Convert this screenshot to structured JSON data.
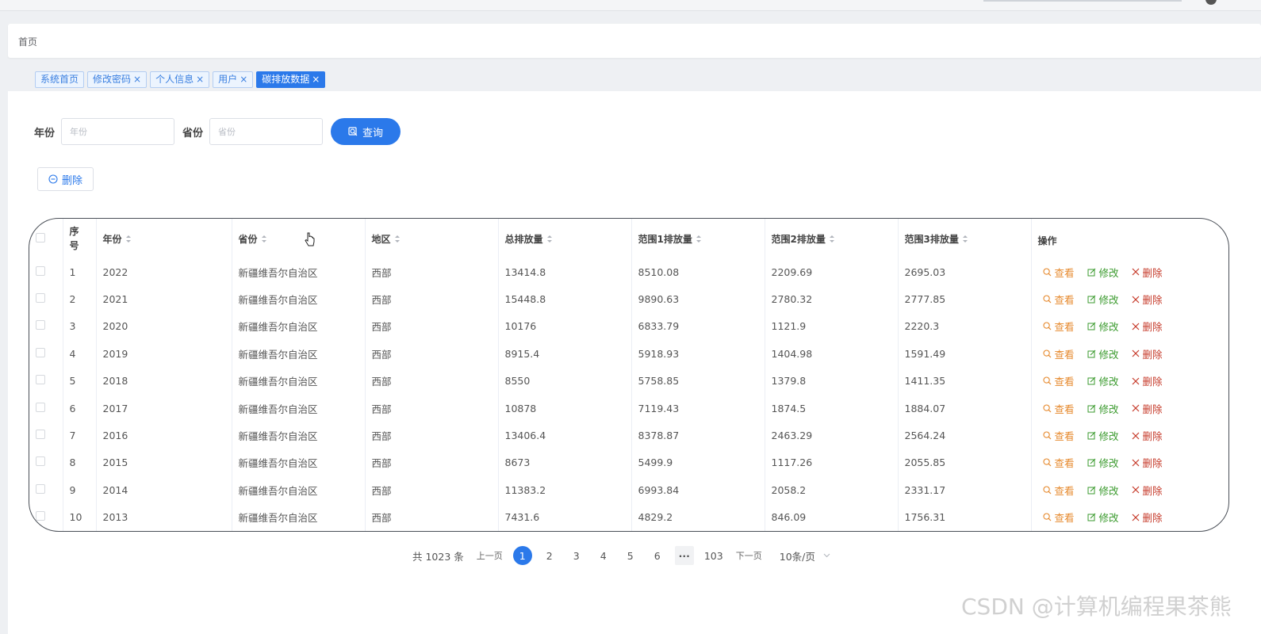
{
  "breadcrumb": {
    "home": "首页"
  },
  "tags": [
    {
      "label": "系统首页",
      "closable": false,
      "active": false
    },
    {
      "label": "修改密码",
      "closable": true,
      "active": false
    },
    {
      "label": "个人信息",
      "closable": true,
      "active": false
    },
    {
      "label": "用户",
      "closable": true,
      "active": false
    },
    {
      "label": "碳排放数据",
      "closable": true,
      "active": true
    }
  ],
  "filter": {
    "year_label": "年份",
    "year_placeholder": "年份",
    "province_label": "省份",
    "province_placeholder": "省份",
    "query_label": "查询"
  },
  "toolbar": {
    "delete_label": "删除"
  },
  "table": {
    "columns": [
      "序\n号",
      "年份",
      "省份",
      "地区",
      "总排放量",
      "范围1排放量",
      "范围2排放量",
      "范围3排放量",
      "操作"
    ],
    "sortable": [
      false,
      true,
      true,
      true,
      true,
      true,
      true,
      true,
      false
    ],
    "actions": {
      "view": "查看",
      "edit": "修改",
      "delete": "删除"
    },
    "rows": [
      [
        "1",
        "2022",
        "新疆维吾尔自治区",
        "西部",
        "13414.8",
        "8510.08",
        "2209.69",
        "2695.03"
      ],
      [
        "2",
        "2021",
        "新疆维吾尔自治区",
        "西部",
        "15448.8",
        "9890.63",
        "2780.32",
        "2777.85"
      ],
      [
        "3",
        "2020",
        "新疆维吾尔自治区",
        "西部",
        "10176",
        "6833.79",
        "1121.9",
        "2220.3"
      ],
      [
        "4",
        "2019",
        "新疆维吾尔自治区",
        "西部",
        "8915.4",
        "5918.93",
        "1404.98",
        "1591.49"
      ],
      [
        "5",
        "2018",
        "新疆维吾尔自治区",
        "西部",
        "8550",
        "5758.85",
        "1379.8",
        "1411.35"
      ],
      [
        "6",
        "2017",
        "新疆维吾尔自治区",
        "西部",
        "10878",
        "7119.43",
        "1874.5",
        "1884.07"
      ],
      [
        "7",
        "2016",
        "新疆维吾尔自治区",
        "西部",
        "13406.4",
        "8378.87",
        "2463.29",
        "2564.24"
      ],
      [
        "8",
        "2015",
        "新疆维吾尔自治区",
        "西部",
        "8673",
        "5499.9",
        "1117.26",
        "2055.85"
      ],
      [
        "9",
        "2014",
        "新疆维吾尔自治区",
        "西部",
        "11383.2",
        "6993.84",
        "2058.2",
        "2331.17"
      ],
      [
        "10",
        "2013",
        "新疆维吾尔自治区",
        "西部",
        "7431.6",
        "4829.2",
        "846.09",
        "1756.31"
      ]
    ]
  },
  "pagination": {
    "total_text": "共 1023 条",
    "prev": "上一页",
    "pages": [
      "1",
      "2",
      "3",
      "4",
      "5",
      "6",
      "···",
      "103"
    ],
    "active_page": "1",
    "next": "下一页",
    "page_size": "10条/页"
  },
  "watermark": "CSDN @计算机编程果茶熊",
  "colors": {
    "primary": "#2b79ea",
    "view": "#e6892d",
    "edit": "#3a9a2d",
    "delete": "#c63a2a"
  }
}
